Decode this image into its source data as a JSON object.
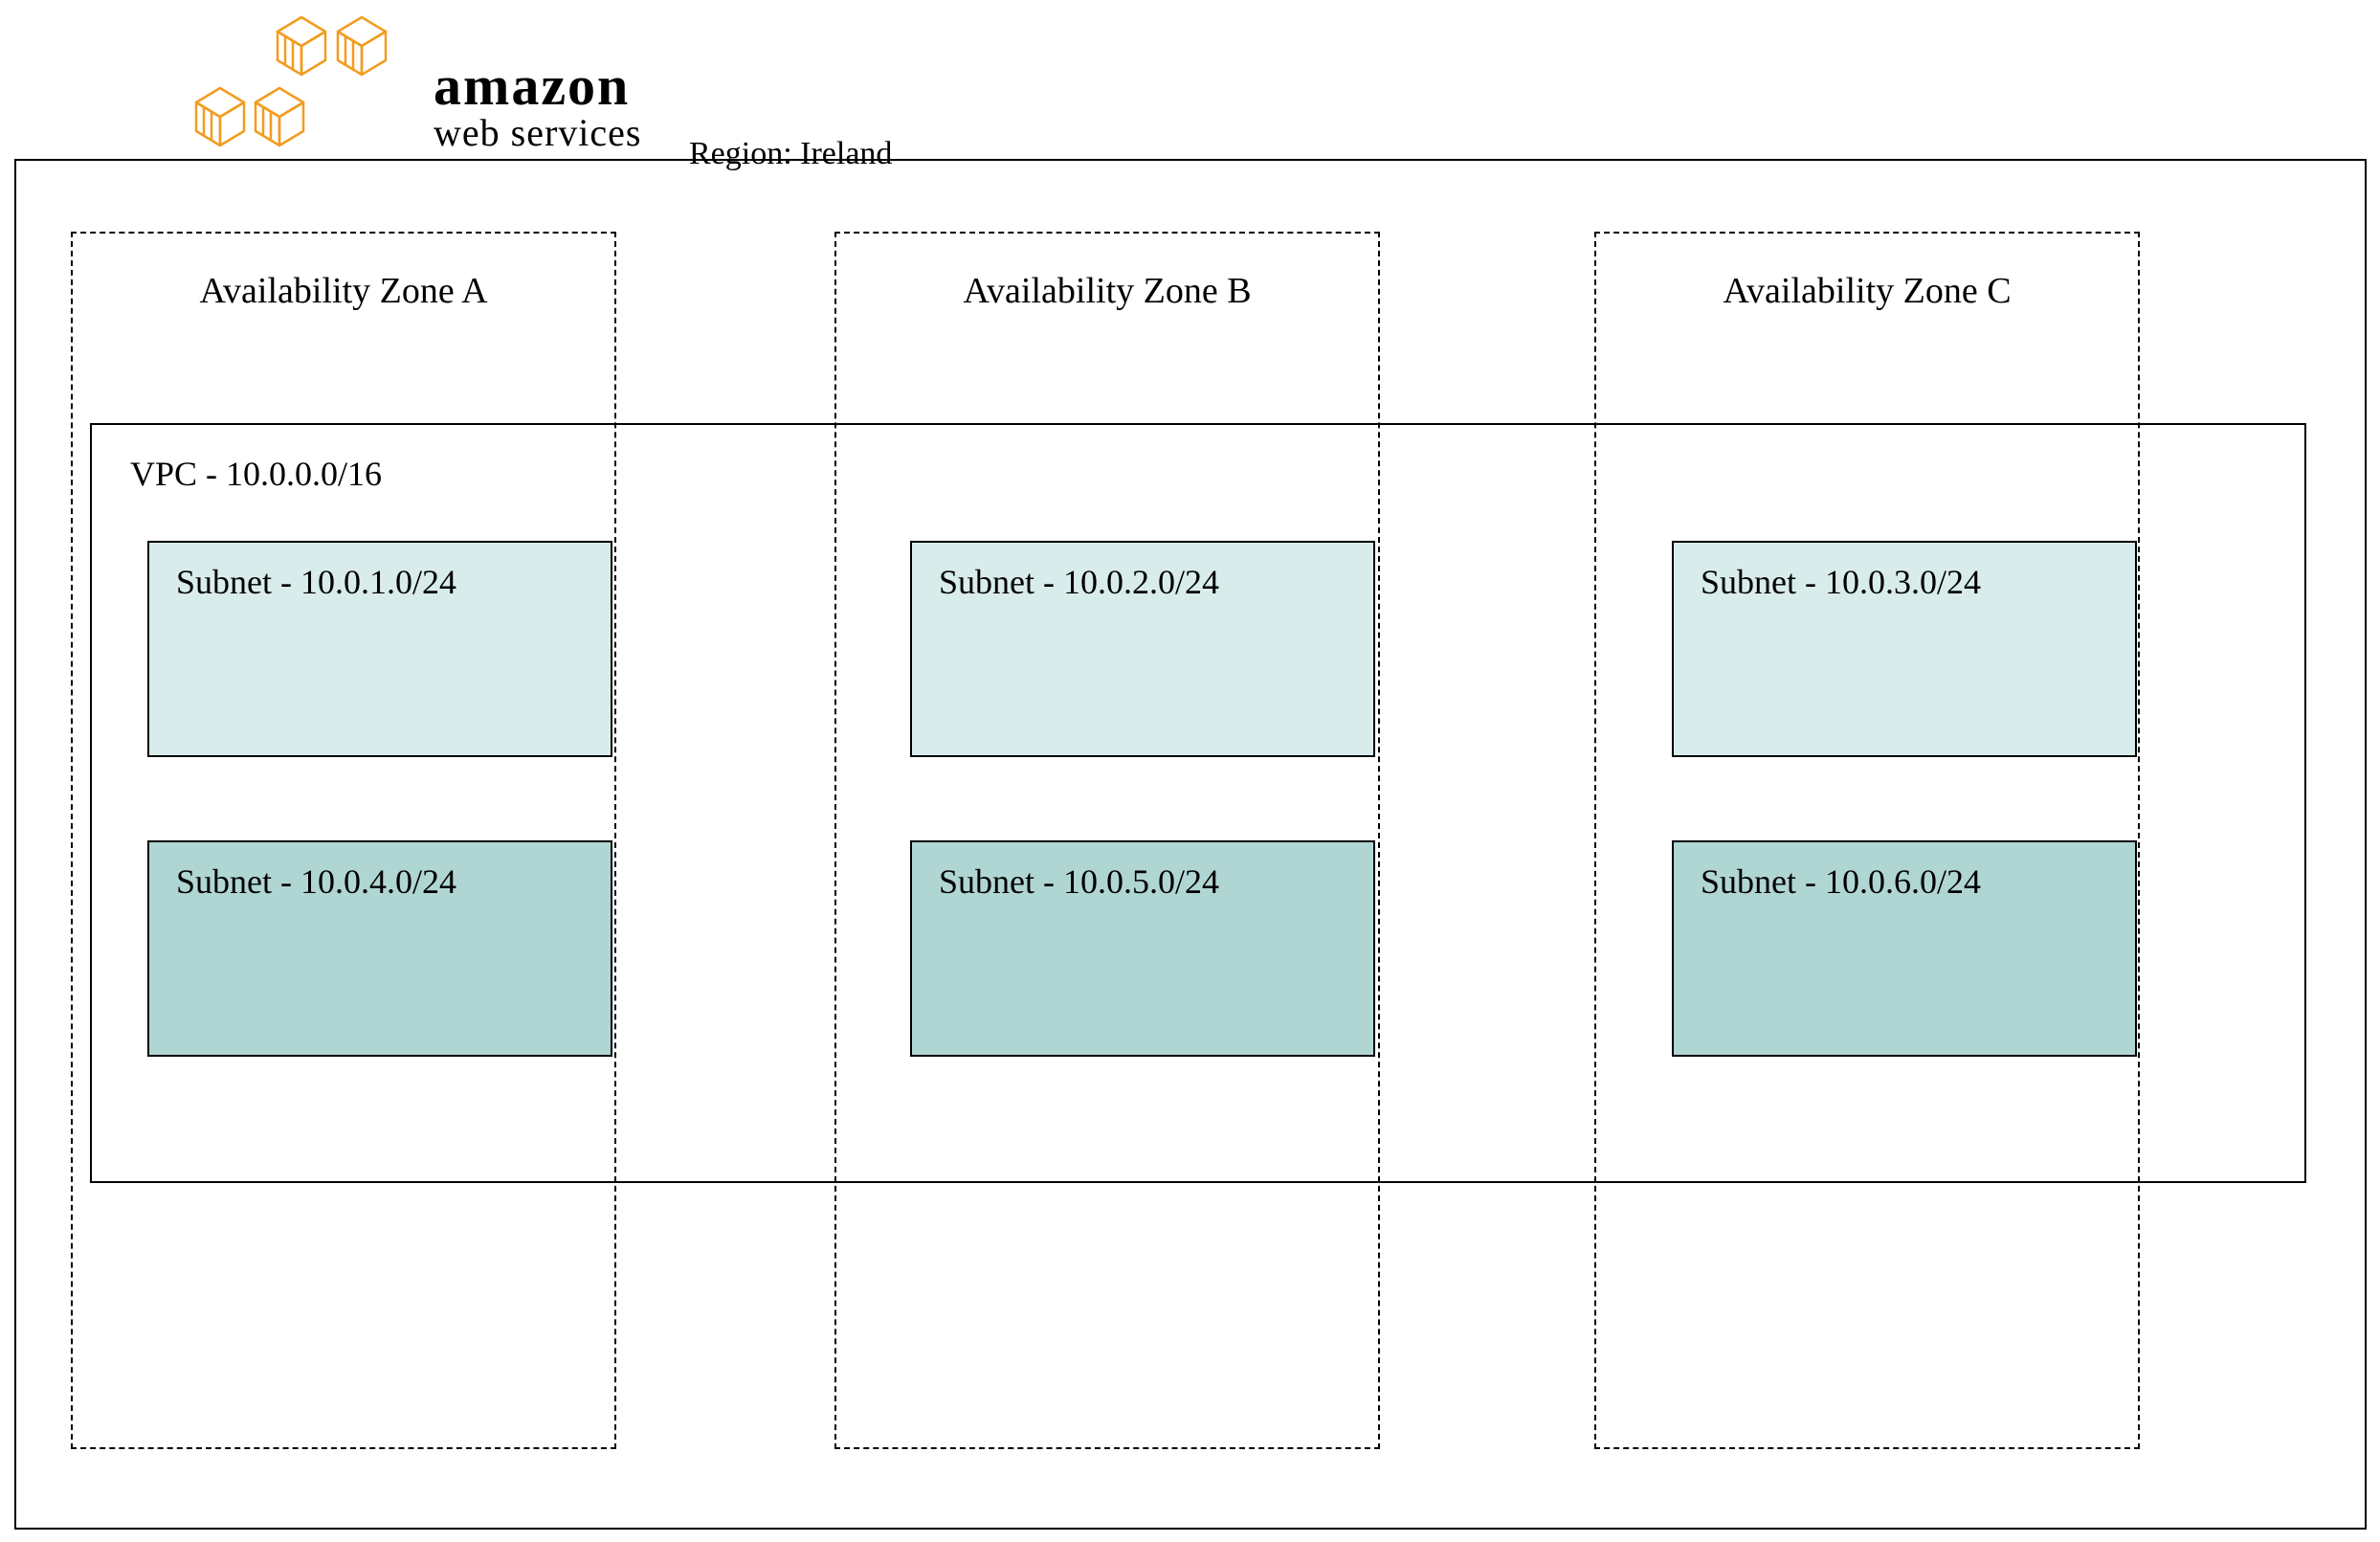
{
  "logo": {
    "primary": "amazon",
    "secondary": "web services"
  },
  "region": {
    "label": "Region: Ireland"
  },
  "availability_zones": [
    {
      "label": "Availability Zone A"
    },
    {
      "label": "Availability Zone B"
    },
    {
      "label": "Availability Zone C"
    }
  ],
  "vpc": {
    "label": "VPC - 10.0.0.0/16",
    "subnets": [
      {
        "label": "Subnet - 10.0.1.0/24",
        "row": 1,
        "col": 1,
        "shade": "light"
      },
      {
        "label": "Subnet - 10.0.2.0/24",
        "row": 1,
        "col": 2,
        "shade": "light"
      },
      {
        "label": "Subnet - 10.0.3.0/24",
        "row": 1,
        "col": 3,
        "shade": "light"
      },
      {
        "label": "Subnet - 10.0.4.0/24",
        "row": 2,
        "col": 1,
        "shade": "dark"
      },
      {
        "label": "Subnet - 10.0.5.0/24",
        "row": 2,
        "col": 2,
        "shade": "dark"
      },
      {
        "label": "Subnet - 10.0.6.0/24",
        "row": 2,
        "col": 3,
        "shade": "dark"
      }
    ]
  },
  "colors": {
    "subnet_light": "#d9ecec",
    "subnet_dark": "#b0d6d3",
    "aws_orange": "#f29c1f"
  }
}
